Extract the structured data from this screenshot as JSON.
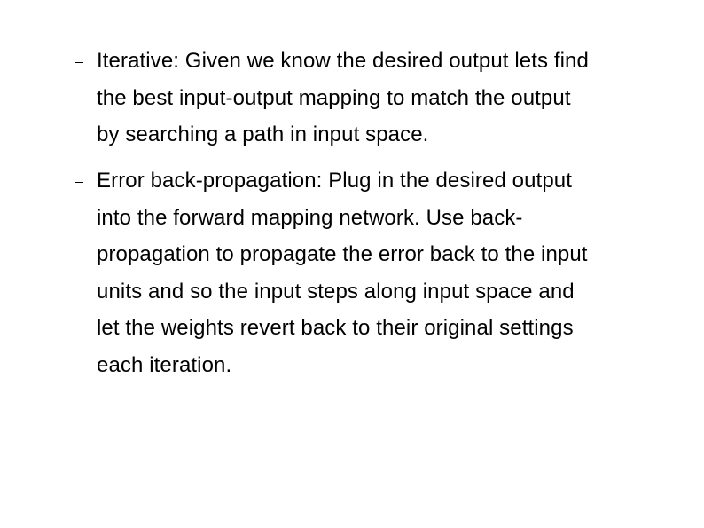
{
  "slide": {
    "bullets": [
      {
        "icon": "dash-bullet-icon",
        "text": "Iterative: Given we know the desired output lets find\nthe best input-output mapping to match the output\nby searching a path in input space."
      },
      {
        "icon": "dash-bullet-icon",
        "text": "Error back-propagation:  Plug in the desired output\ninto the forward mapping network. Use back-\npropagation to propagate the error back to the input\nunits and so the input steps along input space and\nlet the weights revert back to their original settings\neach iteration."
      }
    ]
  }
}
